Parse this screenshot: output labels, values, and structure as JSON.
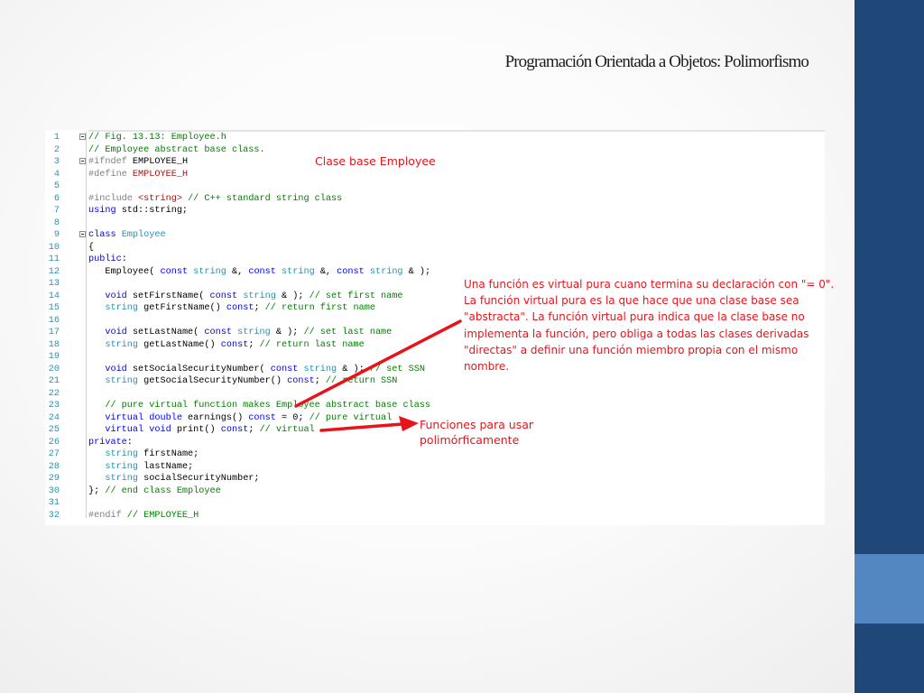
{
  "slide_title": "Programación Orientada a Objetos: Polimorfismo",
  "theme": {
    "sidebar_color": "#1f4879",
    "sidebar_accent": "#5287c2",
    "annotation_color": "#e8141b"
  },
  "code": {
    "lines": [
      {
        "n": "1",
        "fold": true,
        "tokens": [
          {
            "t": "// Fig. 13.13: Employee.h",
            "c": "cm"
          }
        ]
      },
      {
        "n": "2",
        "tokens": [
          {
            "t": "// Employee abstract base class.",
            "c": "cm"
          }
        ]
      },
      {
        "n": "3",
        "fold": true,
        "tokens": [
          {
            "t": "#ifndef ",
            "c": "pp"
          },
          {
            "t": "EMPLOYEE_H",
            "c": ""
          }
        ]
      },
      {
        "n": "4",
        "tokens": [
          {
            "t": "#define ",
            "c": "pp"
          },
          {
            "t": "EMPLOYEE_H",
            "c": "st"
          }
        ]
      },
      {
        "n": "5",
        "tokens": []
      },
      {
        "n": "6",
        "tokens": [
          {
            "t": "#include ",
            "c": "pp"
          },
          {
            "t": "<string>",
            "c": "st"
          },
          {
            "t": " // C++ standard string class",
            "c": "cm"
          }
        ]
      },
      {
        "n": "7",
        "tokens": [
          {
            "t": "using ",
            "c": "kw"
          },
          {
            "t": "std::string;",
            "c": ""
          }
        ]
      },
      {
        "n": "8",
        "tokens": []
      },
      {
        "n": "9",
        "fold": true,
        "tokens": [
          {
            "t": "class ",
            "c": "kw"
          },
          {
            "t": "Employee",
            "c": "ty"
          }
        ]
      },
      {
        "n": "10",
        "tokens": [
          {
            "t": "{",
            "c": ""
          }
        ]
      },
      {
        "n": "11",
        "tokens": [
          {
            "t": "public",
            "c": "kw"
          },
          {
            "t": ":",
            "c": ""
          }
        ]
      },
      {
        "n": "12",
        "tokens": [
          {
            "t": "   Employee( ",
            "c": ""
          },
          {
            "t": "const ",
            "c": "kw"
          },
          {
            "t": "string",
            "c": "ty"
          },
          {
            "t": " &, ",
            "c": ""
          },
          {
            "t": "const ",
            "c": "kw"
          },
          {
            "t": "string",
            "c": "ty"
          },
          {
            "t": " &, ",
            "c": ""
          },
          {
            "t": "const ",
            "c": "kw"
          },
          {
            "t": "string",
            "c": "ty"
          },
          {
            "t": " & );",
            "c": ""
          }
        ]
      },
      {
        "n": "13",
        "tokens": []
      },
      {
        "n": "14",
        "tokens": [
          {
            "t": "   void ",
            "c": "kw"
          },
          {
            "t": "setFirstName( ",
            "c": ""
          },
          {
            "t": "const ",
            "c": "kw"
          },
          {
            "t": "string",
            "c": "ty"
          },
          {
            "t": " & ); ",
            "c": ""
          },
          {
            "t": "// set first name",
            "c": "cm"
          }
        ]
      },
      {
        "n": "15",
        "tokens": [
          {
            "t": "   string",
            "c": "ty"
          },
          {
            "t": " getFirstName() ",
            "c": ""
          },
          {
            "t": "const",
            "c": "kw"
          },
          {
            "t": "; ",
            "c": ""
          },
          {
            "t": "// return first name",
            "c": "cm"
          }
        ]
      },
      {
        "n": "16",
        "tokens": []
      },
      {
        "n": "17",
        "tokens": [
          {
            "t": "   void ",
            "c": "kw"
          },
          {
            "t": "setLastName( ",
            "c": ""
          },
          {
            "t": "const ",
            "c": "kw"
          },
          {
            "t": "string",
            "c": "ty"
          },
          {
            "t": " & ); ",
            "c": ""
          },
          {
            "t": "// set last name",
            "c": "cm"
          }
        ]
      },
      {
        "n": "18",
        "tokens": [
          {
            "t": "   string",
            "c": "ty"
          },
          {
            "t": " getLastName() ",
            "c": ""
          },
          {
            "t": "const",
            "c": "kw"
          },
          {
            "t": "; ",
            "c": ""
          },
          {
            "t": "// return last name",
            "c": "cm"
          }
        ]
      },
      {
        "n": "19",
        "tokens": []
      },
      {
        "n": "20",
        "tokens": [
          {
            "t": "   void ",
            "c": "kw"
          },
          {
            "t": "setSocialSecurityNumber( ",
            "c": ""
          },
          {
            "t": "const ",
            "c": "kw"
          },
          {
            "t": "string",
            "c": "ty"
          },
          {
            "t": " & ); ",
            "c": ""
          },
          {
            "t": "// set SSN",
            "c": "cm"
          }
        ]
      },
      {
        "n": "21",
        "tokens": [
          {
            "t": "   string",
            "c": "ty"
          },
          {
            "t": " getSocialSecurityNumber() ",
            "c": ""
          },
          {
            "t": "const",
            "c": "kw"
          },
          {
            "t": "; ",
            "c": ""
          },
          {
            "t": "// return SSN",
            "c": "cm"
          }
        ]
      },
      {
        "n": "22",
        "tokens": []
      },
      {
        "n": "23",
        "tokens": [
          {
            "t": "   // pure virtual function makes Employee abstract base class",
            "c": "cm"
          }
        ]
      },
      {
        "n": "24",
        "tokens": [
          {
            "t": "   virtual double ",
            "c": "kw"
          },
          {
            "t": "earnings() ",
            "c": ""
          },
          {
            "t": "const",
            "c": "kw"
          },
          {
            "t": " = 0; ",
            "c": ""
          },
          {
            "t": "// pure virtual",
            "c": "cm"
          }
        ]
      },
      {
        "n": "25",
        "tokens": [
          {
            "t": "   virtual void ",
            "c": "kw"
          },
          {
            "t": "print() ",
            "c": ""
          },
          {
            "t": "const",
            "c": "kw"
          },
          {
            "t": "; ",
            "c": ""
          },
          {
            "t": "// virtual",
            "c": "cm"
          }
        ]
      },
      {
        "n": "26",
        "tokens": [
          {
            "t": "private",
            "c": "kw"
          },
          {
            "t": ":",
            "c": ""
          }
        ]
      },
      {
        "n": "27",
        "tokens": [
          {
            "t": "   string",
            "c": "ty"
          },
          {
            "t": " firstName;",
            "c": ""
          }
        ]
      },
      {
        "n": "28",
        "tokens": [
          {
            "t": "   string",
            "c": "ty"
          },
          {
            "t": " lastName;",
            "c": ""
          }
        ]
      },
      {
        "n": "29",
        "tokens": [
          {
            "t": "   string",
            "c": "ty"
          },
          {
            "t": " socialSecurityNumber;",
            "c": ""
          }
        ]
      },
      {
        "n": "30",
        "tokens": [
          {
            "t": "}; ",
            "c": ""
          },
          {
            "t": "// end class Employee",
            "c": "cm"
          }
        ]
      },
      {
        "n": "31",
        "tokens": []
      },
      {
        "n": "32",
        "tokens": [
          {
            "t": "#endif ",
            "c": "pp"
          },
          {
            "t": "// EMPLOYEE_H",
            "c": "cm"
          }
        ]
      }
    ]
  },
  "annotations": {
    "base_class": "Clase base Employee",
    "pure_virtual": "Una función es virtual pura cuano termina su declaración con \"= 0\". La función virtual pura es la que hace que una clase base sea \"abstracta\". La función virtual pura indica que la clase base no implementa la función, pero obliga a todas las clases derivadas \"directas\" a definir una función miembro propia con el mismo nombre.",
    "polymorphic": "Funciones para usar polimórficamente"
  }
}
